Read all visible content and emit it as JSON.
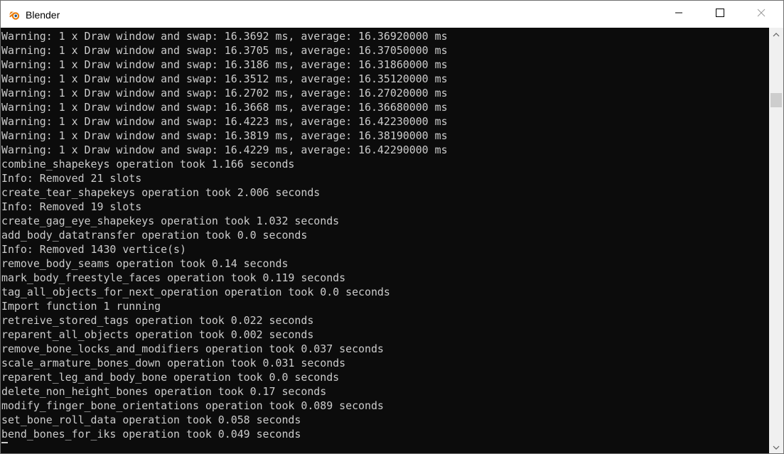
{
  "window": {
    "title": "Blender",
    "app_icon": "blender-icon",
    "controls": [
      "minimize-icon",
      "maximize-icon",
      "close-icon"
    ]
  },
  "console": {
    "lines": [
      "Warning: 1 x Draw window and swap: 16.3692 ms, average: 16.36920000 ms",
      "Warning: 1 x Draw window and swap: 16.3705 ms, average: 16.37050000 ms",
      "Warning: 1 x Draw window and swap: 16.3186 ms, average: 16.31860000 ms",
      "Warning: 1 x Draw window and swap: 16.3512 ms, average: 16.35120000 ms",
      "Warning: 1 x Draw window and swap: 16.2702 ms, average: 16.27020000 ms",
      "Warning: 1 x Draw window and swap: 16.3668 ms, average: 16.36680000 ms",
      "Warning: 1 x Draw window and swap: 16.4223 ms, average: 16.42230000 ms",
      "Warning: 1 x Draw window and swap: 16.3819 ms, average: 16.38190000 ms",
      "Warning: 1 x Draw window and swap: 16.4229 ms, average: 16.42290000 ms",
      "combine_shapekeys operation took 1.166 seconds",
      "Info: Removed 21 slots",
      "create_tear_shapekeys operation took 2.006 seconds",
      "Info: Removed 19 slots",
      "create_gag_eye_shapekeys operation took 1.032 seconds",
      "add_body_datatransfer operation took 0.0 seconds",
      "Info: Removed 1430 vertice(s)",
      "remove_body_seams operation took 0.14 seconds",
      "mark_body_freestyle_faces operation took 0.119 seconds",
      "tag_all_objects_for_next_operation operation took 0.0 seconds",
      "Import function 1 running",
      "retreive_stored_tags operation took 0.022 seconds",
      "reparent_all_objects operation took 0.002 seconds",
      "remove_bone_locks_and_modifiers operation took 0.037 seconds",
      "scale_armature_bones_down operation took 0.031 seconds",
      "reparent_leg_and_body_bone operation took 0.0 seconds",
      "delete_non_height_bones operation took 0.17 seconds",
      "modify_finger_bone_orientations operation took 0.089 seconds",
      "set_bone_roll_data operation took 0.058 seconds",
      "bend_bones_for_iks operation took 0.049 seconds"
    ]
  },
  "scrollbar": {
    "icons": [
      "chevron-up-icon",
      "chevron-down-icon"
    ]
  },
  "colors": {
    "console_bg": "#0c0c0c",
    "console_text": "#cccccc",
    "titlebar_bg": "#ffffff",
    "scrollbar_track": "#f0f0f0",
    "scrollbar_thumb": "#cdcdcd",
    "blender_orange": "#e87d0d",
    "blender_blue": "#265787"
  }
}
